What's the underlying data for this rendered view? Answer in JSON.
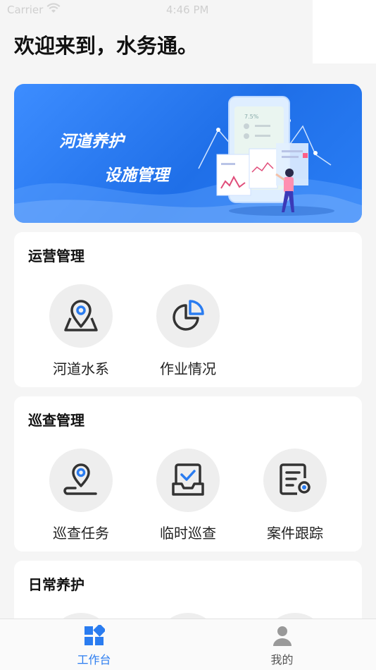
{
  "status_bar": {
    "carrier": "Carrier",
    "time": "4:46 PM"
  },
  "welcome": "欢迎来到，水务通。",
  "banner": {
    "line1": "河道养护",
    "line2": "设施管理",
    "phone_text": "7.5%"
  },
  "sections": [
    {
      "title": "运营管理",
      "items": [
        {
          "label": "河道水系",
          "icon": "map-pin-icon"
        },
        {
          "label": "作业情况",
          "icon": "pie-chart-icon"
        }
      ]
    },
    {
      "title": "巡查管理",
      "items": [
        {
          "label": "巡查任务",
          "icon": "route-pin-icon"
        },
        {
          "label": "临时巡查",
          "icon": "inbox-check-icon"
        },
        {
          "label": "案件跟踪",
          "icon": "document-track-icon"
        }
      ]
    },
    {
      "title": "日常养护",
      "items": []
    }
  ],
  "tabbar": {
    "tabs": [
      {
        "label": "工作台",
        "icon": "grid-icon",
        "active": true
      },
      {
        "label": "我的",
        "icon": "person-icon",
        "active": false
      }
    ]
  },
  "colors": {
    "accent": "#2a7cf0",
    "icon_dark": "#333333",
    "background": "#f5f5f5"
  }
}
